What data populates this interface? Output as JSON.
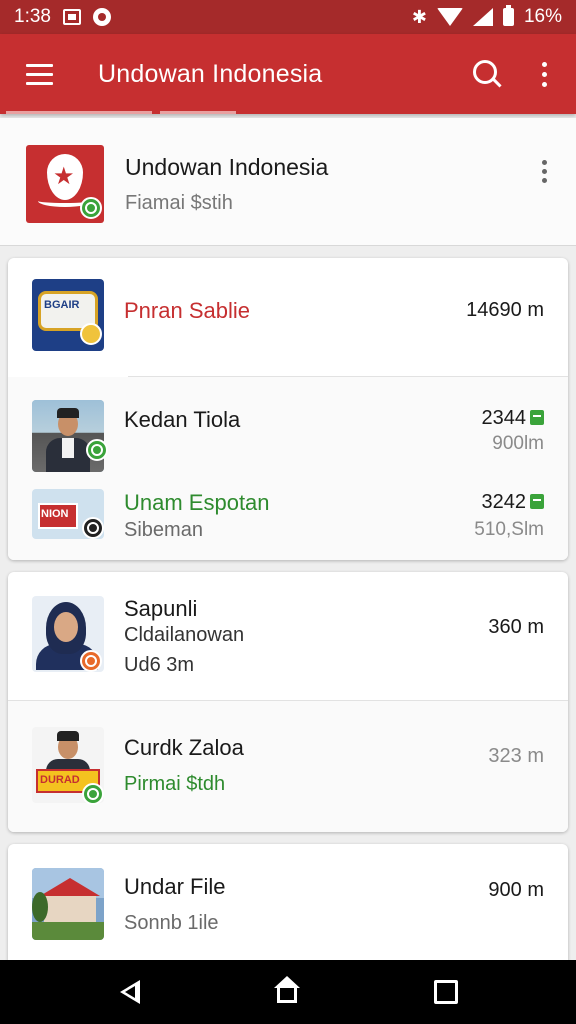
{
  "status_bar": {
    "time": "1:38",
    "battery": "16%"
  },
  "app_bar": {
    "title": "Undowan Indonesia",
    "menu_icon": "menu-icon",
    "search_icon": "search-icon",
    "more_icon": "more-vert-icon"
  },
  "header": {
    "title": "Undowan Indonesia",
    "subtitle": "Fiamai $stih"
  },
  "card1": {
    "rows": [
      {
        "title": "Pnran Sablie",
        "value": "14690 m",
        "title_color": "#c62f30"
      }
    ]
  },
  "card2": {
    "rows": [
      {
        "title": "Kedan Tiola",
        "value": "2344",
        "value2": "900lm",
        "title_color": "#1a1a1a"
      },
      {
        "title": "Unam Espotan",
        "subtitle": "Sibeman",
        "value": "3242",
        "value2": "510,Slm",
        "title_color": "#2e8b2e"
      }
    ]
  },
  "card3": {
    "rows": [
      {
        "title": "Sapunli",
        "subtitle": "Cldailanowan",
        "subtitle2": "Ud6 3m",
        "value": "360 m"
      },
      {
        "title": "Curdk Zaloa",
        "subtitle": "Pirmai $tdh",
        "value": "323 m",
        "subtitle_color": "#2e8b2e"
      }
    ]
  },
  "card4": {
    "rows": [
      {
        "title": "Undar File",
        "subtitle": "Sonnb 1ile",
        "value": "900 m"
      }
    ]
  },
  "thumb_texts": {
    "logo": "BGAIR",
    "sign": "NION",
    "banner": "DURAD"
  },
  "colors": {
    "primary": "#c62f30",
    "status_bar": "#a52a2a",
    "accent_green": "#3aa33a"
  }
}
